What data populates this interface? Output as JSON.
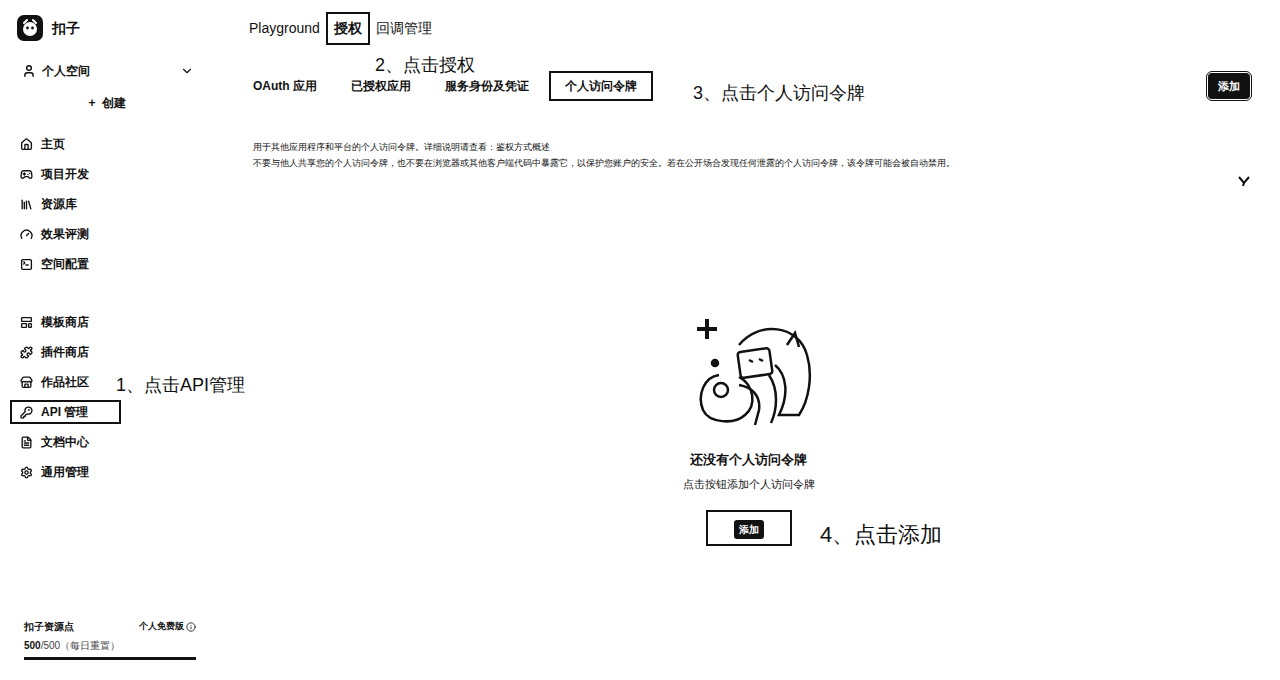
{
  "app": {
    "name": "扣子"
  },
  "workspace": {
    "label": "个人空间",
    "expanded": false
  },
  "create": {
    "icon": "+",
    "label": "创建"
  },
  "sidebar": {
    "groups": [
      [
        {
          "label": "主页",
          "selected": false
        },
        {
          "label": "项目开发",
          "selected": false
        },
        {
          "label": "资源库",
          "selected": false
        },
        {
          "label": "效果评测",
          "selected": false
        },
        {
          "label": "空间配置",
          "selected": false
        }
      ],
      [
        {
          "label": "模板商店",
          "selected": false
        },
        {
          "label": "插件商店",
          "selected": false
        },
        {
          "label": "作品社区",
          "selected": false
        },
        {
          "label": "API 管理",
          "selected": true
        },
        {
          "label": "文档中心",
          "selected": false
        },
        {
          "label": "通用管理",
          "selected": false
        }
      ]
    ]
  },
  "resource": {
    "title": "扣子资源点",
    "plan": "个人免费版",
    "used": "500",
    "total": "/500（每日重置）",
    "level": 1
  },
  "top_tabs": [
    {
      "label": "Playground",
      "selected": false
    },
    {
      "label": "授权",
      "selected": true
    },
    {
      "label": "回调管理",
      "selected": false
    }
  ],
  "sub_tabs": [
    {
      "label": "OAuth 应用",
      "selected": false
    },
    {
      "label": "已授权应用",
      "selected": false
    },
    {
      "label": "服务身份及凭证",
      "selected": false
    },
    {
      "label": "个人访问令牌",
      "selected": true
    }
  ],
  "add_button": "添加",
  "description": [
    "用于其他应用程序和平台的个人访问令牌。详细说明请查看：鉴权方式概述",
    "不要与他人共享您的个人访问令牌，也不要在浏览器或其他客户端代码中暴露它，以保护您账户的安全。若在公开场合发现任何泄露的个人访问令牌，该令牌可能会被自动禁用。"
  ],
  "empty": {
    "title": "还没有个人访问令牌",
    "hint": "点击按钮添加个人访问令牌",
    "button": "添加"
  },
  "annotations": [
    "1、点击API管理",
    "2、点击授权",
    "3、点击个人访问令牌",
    "4、点击添加"
  ]
}
